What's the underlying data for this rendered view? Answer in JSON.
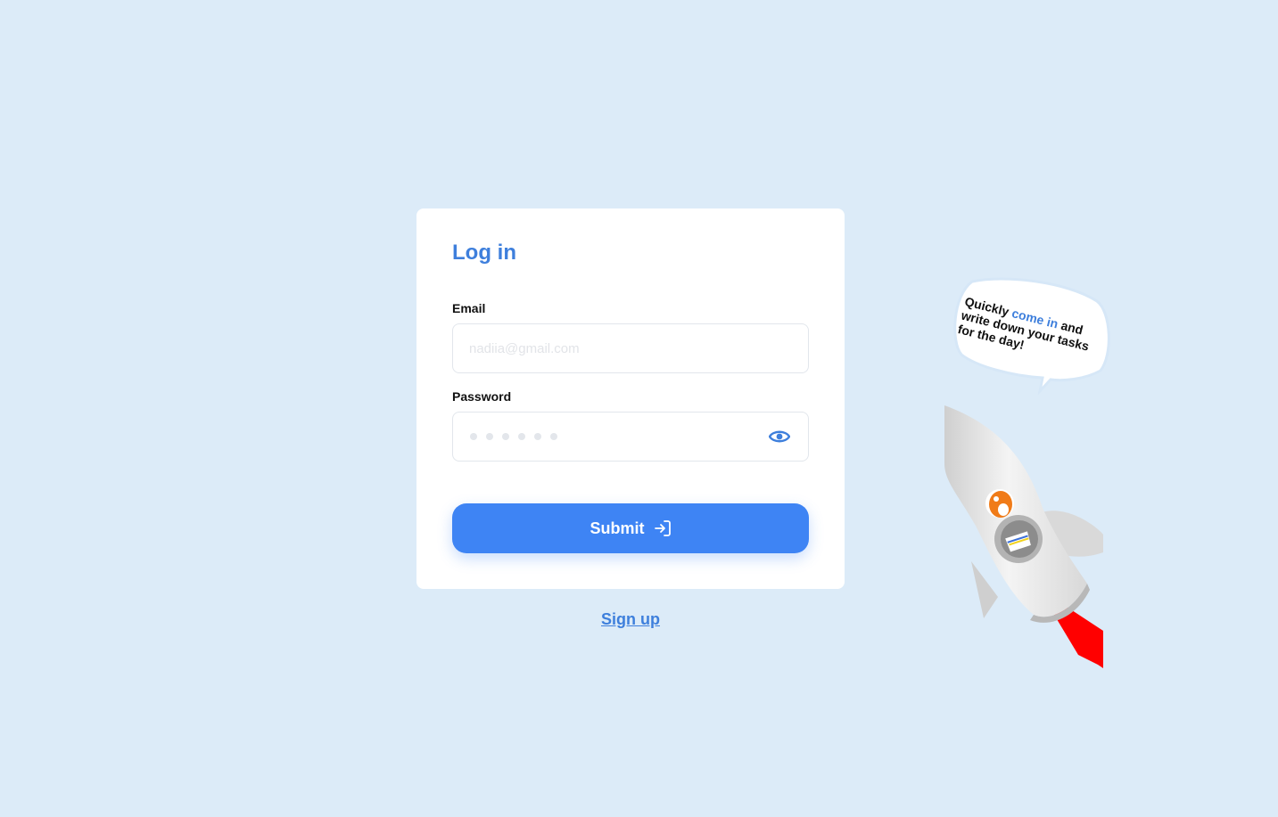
{
  "form": {
    "title": "Log in",
    "email_label": "Email",
    "email_placeholder": "nadiia@gmail.com",
    "password_label": "Password",
    "password_dot_count": 6,
    "submit_label": "Submit",
    "show_password_icon": "eye-icon",
    "submit_icon": "sign-in-arrow-icon"
  },
  "signup_link": "Sign up",
  "illustration": {
    "bubble_text_before": "Quickly",
    "bubble_text_highlight": "come in",
    "bubble_text_after": "and write down your tasks for the day!"
  },
  "colors": {
    "background": "#dcebf8",
    "accent": "#3e7fdc",
    "button": "#3e84f4",
    "card": "#ffffff"
  }
}
